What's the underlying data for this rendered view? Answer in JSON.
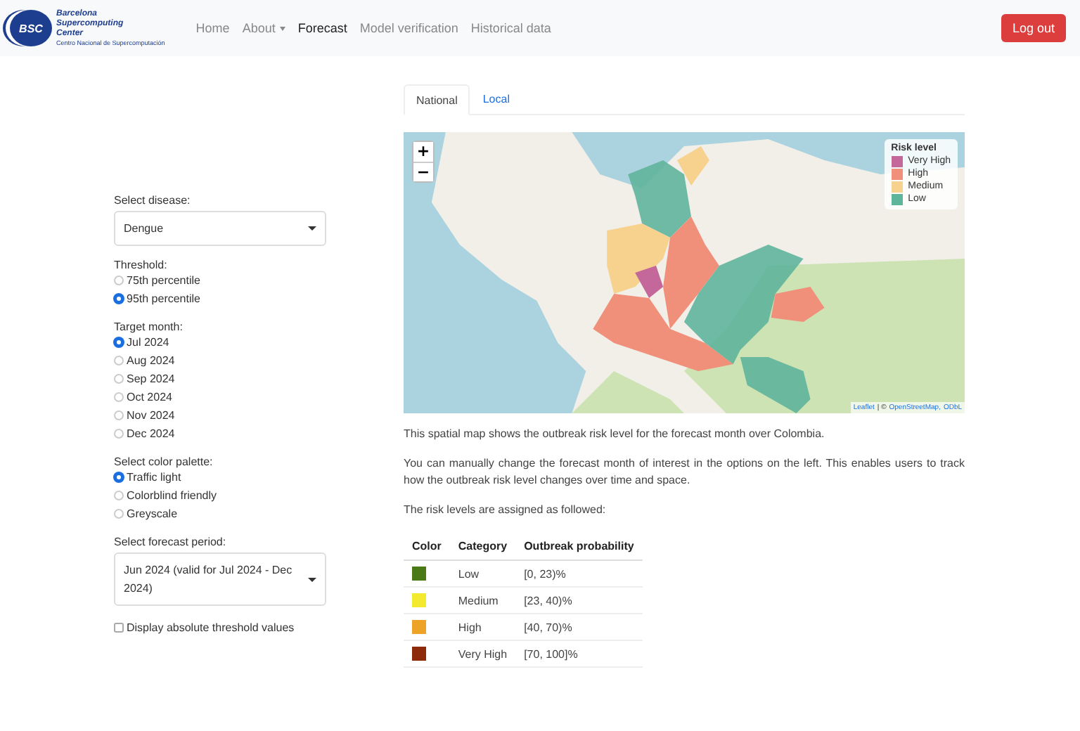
{
  "navbar": {
    "logo": {
      "badge": "BSC",
      "lines": [
        "Barcelona",
        "Supercomputing",
        "Center"
      ],
      "subtitle": "Centro Nacional de Supercomputación"
    },
    "items": [
      {
        "label": "Home",
        "selected": false,
        "kind": "link"
      },
      {
        "label": "About",
        "selected": false,
        "kind": "dropdown"
      },
      {
        "label": "Forecast",
        "selected": true,
        "kind": "link"
      },
      {
        "label": "Model verification",
        "selected": false,
        "kind": "link"
      },
      {
        "label": "Historical data",
        "selected": false,
        "kind": "link"
      }
    ],
    "logout": "Log out"
  },
  "sidebar": [
    {
      "kind": "select",
      "label": "Select disease:",
      "value": "Dengue"
    },
    {
      "kind": "radio",
      "label": "Threshold:",
      "options": [
        {
          "label": "75th percentile",
          "selected": false
        },
        {
          "label": "95th percentile",
          "selected": true
        }
      ]
    },
    {
      "kind": "radio",
      "label": "Target month:",
      "options": [
        {
          "label": "Jul 2024",
          "selected": true
        },
        {
          "label": "Aug 2024",
          "selected": false
        },
        {
          "label": "Sep 2024",
          "selected": false
        },
        {
          "label": "Oct 2024",
          "selected": false
        },
        {
          "label": "Nov 2024",
          "selected": false
        },
        {
          "label": "Dec 2024",
          "selected": false
        }
      ]
    },
    {
      "kind": "radio",
      "label": "Select color palette:",
      "options": [
        {
          "label": "Traffic light",
          "selected": true
        },
        {
          "label": "Colorblind friendly",
          "selected": false
        },
        {
          "label": "Greyscale",
          "selected": false
        }
      ]
    },
    {
      "kind": "select",
      "label": "Select forecast period:",
      "value": "Jun 2024 (valid for Jul 2024 - Dec 2024)"
    },
    {
      "kind": "checkbox",
      "label": "Display absolute threshold values",
      "checked": false
    }
  ],
  "tabs": [
    {
      "label": "National",
      "selected": true
    },
    {
      "label": "Local",
      "selected": false
    }
  ],
  "map": {
    "zoom_in": "+",
    "zoom_out": "−",
    "legend": {
      "title": "Risk level",
      "items": [
        {
          "label": "Very High",
          "color": "#c4679a"
        },
        {
          "label": "High",
          "color": "#f0907a"
        },
        {
          "label": "Medium",
          "color": "#f6d28e"
        },
        {
          "label": "Low",
          "color": "#5fb49c"
        }
      ]
    },
    "attribution": {
      "leaflet": "Leaflet",
      "sep": "| ©",
      "osm": "OpenStreetMap,",
      "odbl": "ODbL"
    }
  },
  "paragraphs": [
    "This spatial map shows the outbreak risk level for the forecast month over Colombia.",
    "You can manually change the forecast month of interest in the options on the left. This enables users to track how the outbreak risk level changes over time and space.",
    "The risk levels are assigned as followed:"
  ],
  "table": {
    "columns": [
      "Color",
      "Category",
      "Outbreak probability"
    ],
    "rows": [
      {
        "color": "#4a7a16",
        "category": "Low",
        "probability": "[0, 23)%"
      },
      {
        "color": "#f3e92e",
        "category": "Medium",
        "probability": "[23, 40)%"
      },
      {
        "color": "#eda327",
        "category": "High",
        "probability": "[40, 70)%"
      },
      {
        "color": "#8c2a0a",
        "category": "Very High",
        "probability": "[70, 100]%"
      }
    ]
  }
}
